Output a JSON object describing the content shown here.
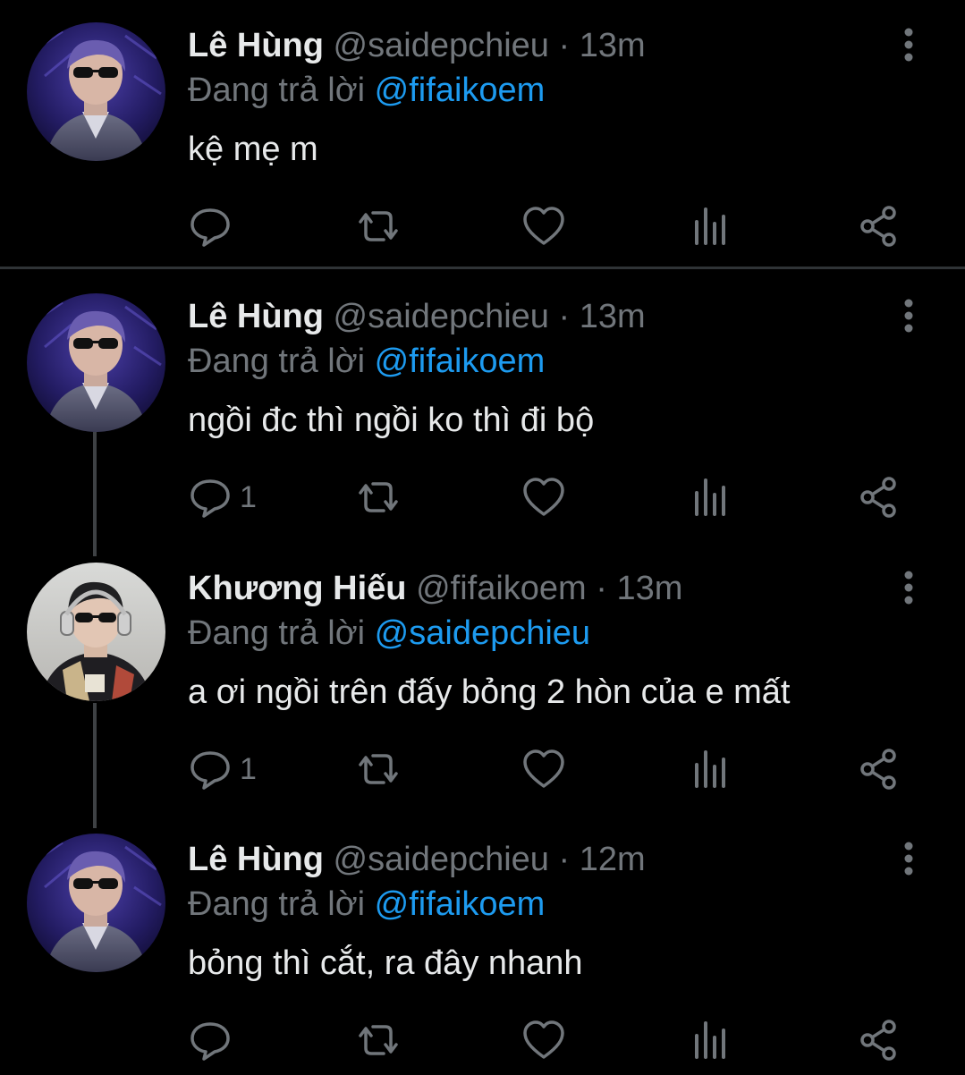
{
  "colors": {
    "background": "#000000",
    "name": "#e7e9ea",
    "secondary": "#71767b",
    "mention": "#1d9bf0",
    "divider": "#2f3336",
    "thread_line": "#3e4144"
  },
  "reply_prefix": "Đang trả lời",
  "tweets": [
    {
      "name": "Lê Hùng",
      "handle": "@saidepchieu",
      "separator": "·",
      "time": "13m",
      "reply_to": "@fifaikoem",
      "text": "kệ mẹ m",
      "reply_count": "",
      "avatar": "avatar-le-hung"
    },
    {
      "name": "Lê Hùng",
      "handle": "@saidepchieu",
      "separator": "·",
      "time": "13m",
      "reply_to": "@fifaikoem",
      "text": "ngồi đc thì ngồi ko thì đi bộ",
      "reply_count": "1",
      "avatar": "avatar-le-hung"
    },
    {
      "name": "Khương Hiếu",
      "handle": "@fifaikoem",
      "separator": "·",
      "time": "13m",
      "reply_to": "@saidepchieu",
      "text": "a ơi ngồi trên đấy bỏng 2 hòn của e mất",
      "reply_count": "1",
      "avatar": "avatar-khuong-hieu"
    },
    {
      "name": "Lê Hùng",
      "handle": "@saidepchieu",
      "separator": "·",
      "time": "12m",
      "reply_to": "@fifaikoem",
      "text": "bỏng thì cắt, ra đây nhanh",
      "reply_count": "",
      "avatar": "avatar-le-hung"
    }
  ],
  "icons": [
    "reply-icon",
    "retweet-icon",
    "like-icon",
    "views-icon",
    "share-icon",
    "more-icon"
  ]
}
